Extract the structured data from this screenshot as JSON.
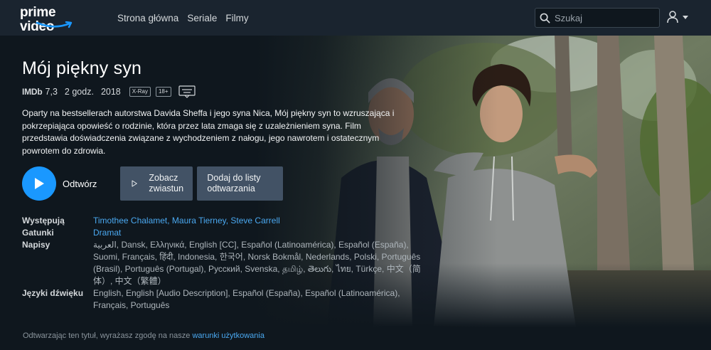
{
  "brand": {
    "logo_text": "prime video",
    "accent": "#1a98ff",
    "link_color": "#4aa8f0",
    "background": "#0f171e"
  },
  "nav": {
    "items": [
      "Strona główna",
      "Seriale",
      "Filmy"
    ]
  },
  "search": {
    "placeholder": "Szukaj",
    "icon": "search-icon"
  },
  "account": {
    "icon": "user-icon"
  },
  "movie": {
    "title": "Mój piękny syn",
    "imdb_label": "IMDb",
    "imdb_rating": "7,3",
    "duration": "2 godz.",
    "year": "2018",
    "badges": [
      "X-Ray",
      "18+"
    ],
    "subtitles_icon": "subtitles-icon",
    "synopsis": "Oparty na bestsellerach autorstwa Davida Sheffa i jego syna Nica, Mój piękny syn to wzruszająca i pokrzepiająca opowieść o rodzinie, która przez lata zmaga się z uzależnieniem syna. Film przedstawia doświadczenia związane z wychodzeniem z nałogu, jego nawrotem i ostatecznym powrotem do zdrowia."
  },
  "actions": {
    "play_label": "Odtwórz",
    "trailer_label": "Zobacz zwiastun",
    "watchlist_label": "Dodaj do listy odtwarzania"
  },
  "info": {
    "cast_label": "Występują",
    "cast": "Timothee Chalamet, Maura Tierney, Steve Carrell",
    "genres_label": "Gatunki",
    "genres": "Dramat",
    "subtitles_label": "Napisy",
    "subtitles": "العربية, Dansk, Ελληνικά, English [CC], Español (Latinoamérica), Español (España), Suomi, Français, हिंदी, Indonesia, 한국어, Norsk Bokmål, Nederlands, Polski, Português (Brasil), Português (Portugal), Русский, Svenska, தமிழ், తెలుగు, ไทย, Türkçe, 中文（简体）, 中文（繁體）",
    "audio_label": "Języki dźwięku",
    "audio": "English, English [Audio Description], Español (España), Español (Latinoamérica), Français, Português"
  },
  "footer": {
    "text": "Odtwarzając ten tytuł, wyrażasz zgodę na nasze",
    "link": "warunki użytkowania"
  }
}
